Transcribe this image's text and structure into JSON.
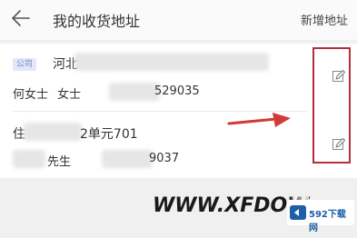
{
  "header": {
    "title": "我的收货地址",
    "action": "新增地址"
  },
  "addresses": [
    {
      "tag": "公司",
      "address": "河北",
      "name": "何女士",
      "name_suffix": "女士",
      "phone": "529035"
    },
    {
      "address_lead": "住",
      "address": "2单元701",
      "name": "先生",
      "phone": "9037"
    }
  ],
  "watermark": {
    "text": "WWW.XFDOW",
    "logo_text": "592下载网"
  },
  "colors": {
    "highlight": "#b2303c",
    "arrow": "#d23a3a",
    "tag_bg": "#e3e8f8",
    "tag_text": "#7186c7"
  }
}
